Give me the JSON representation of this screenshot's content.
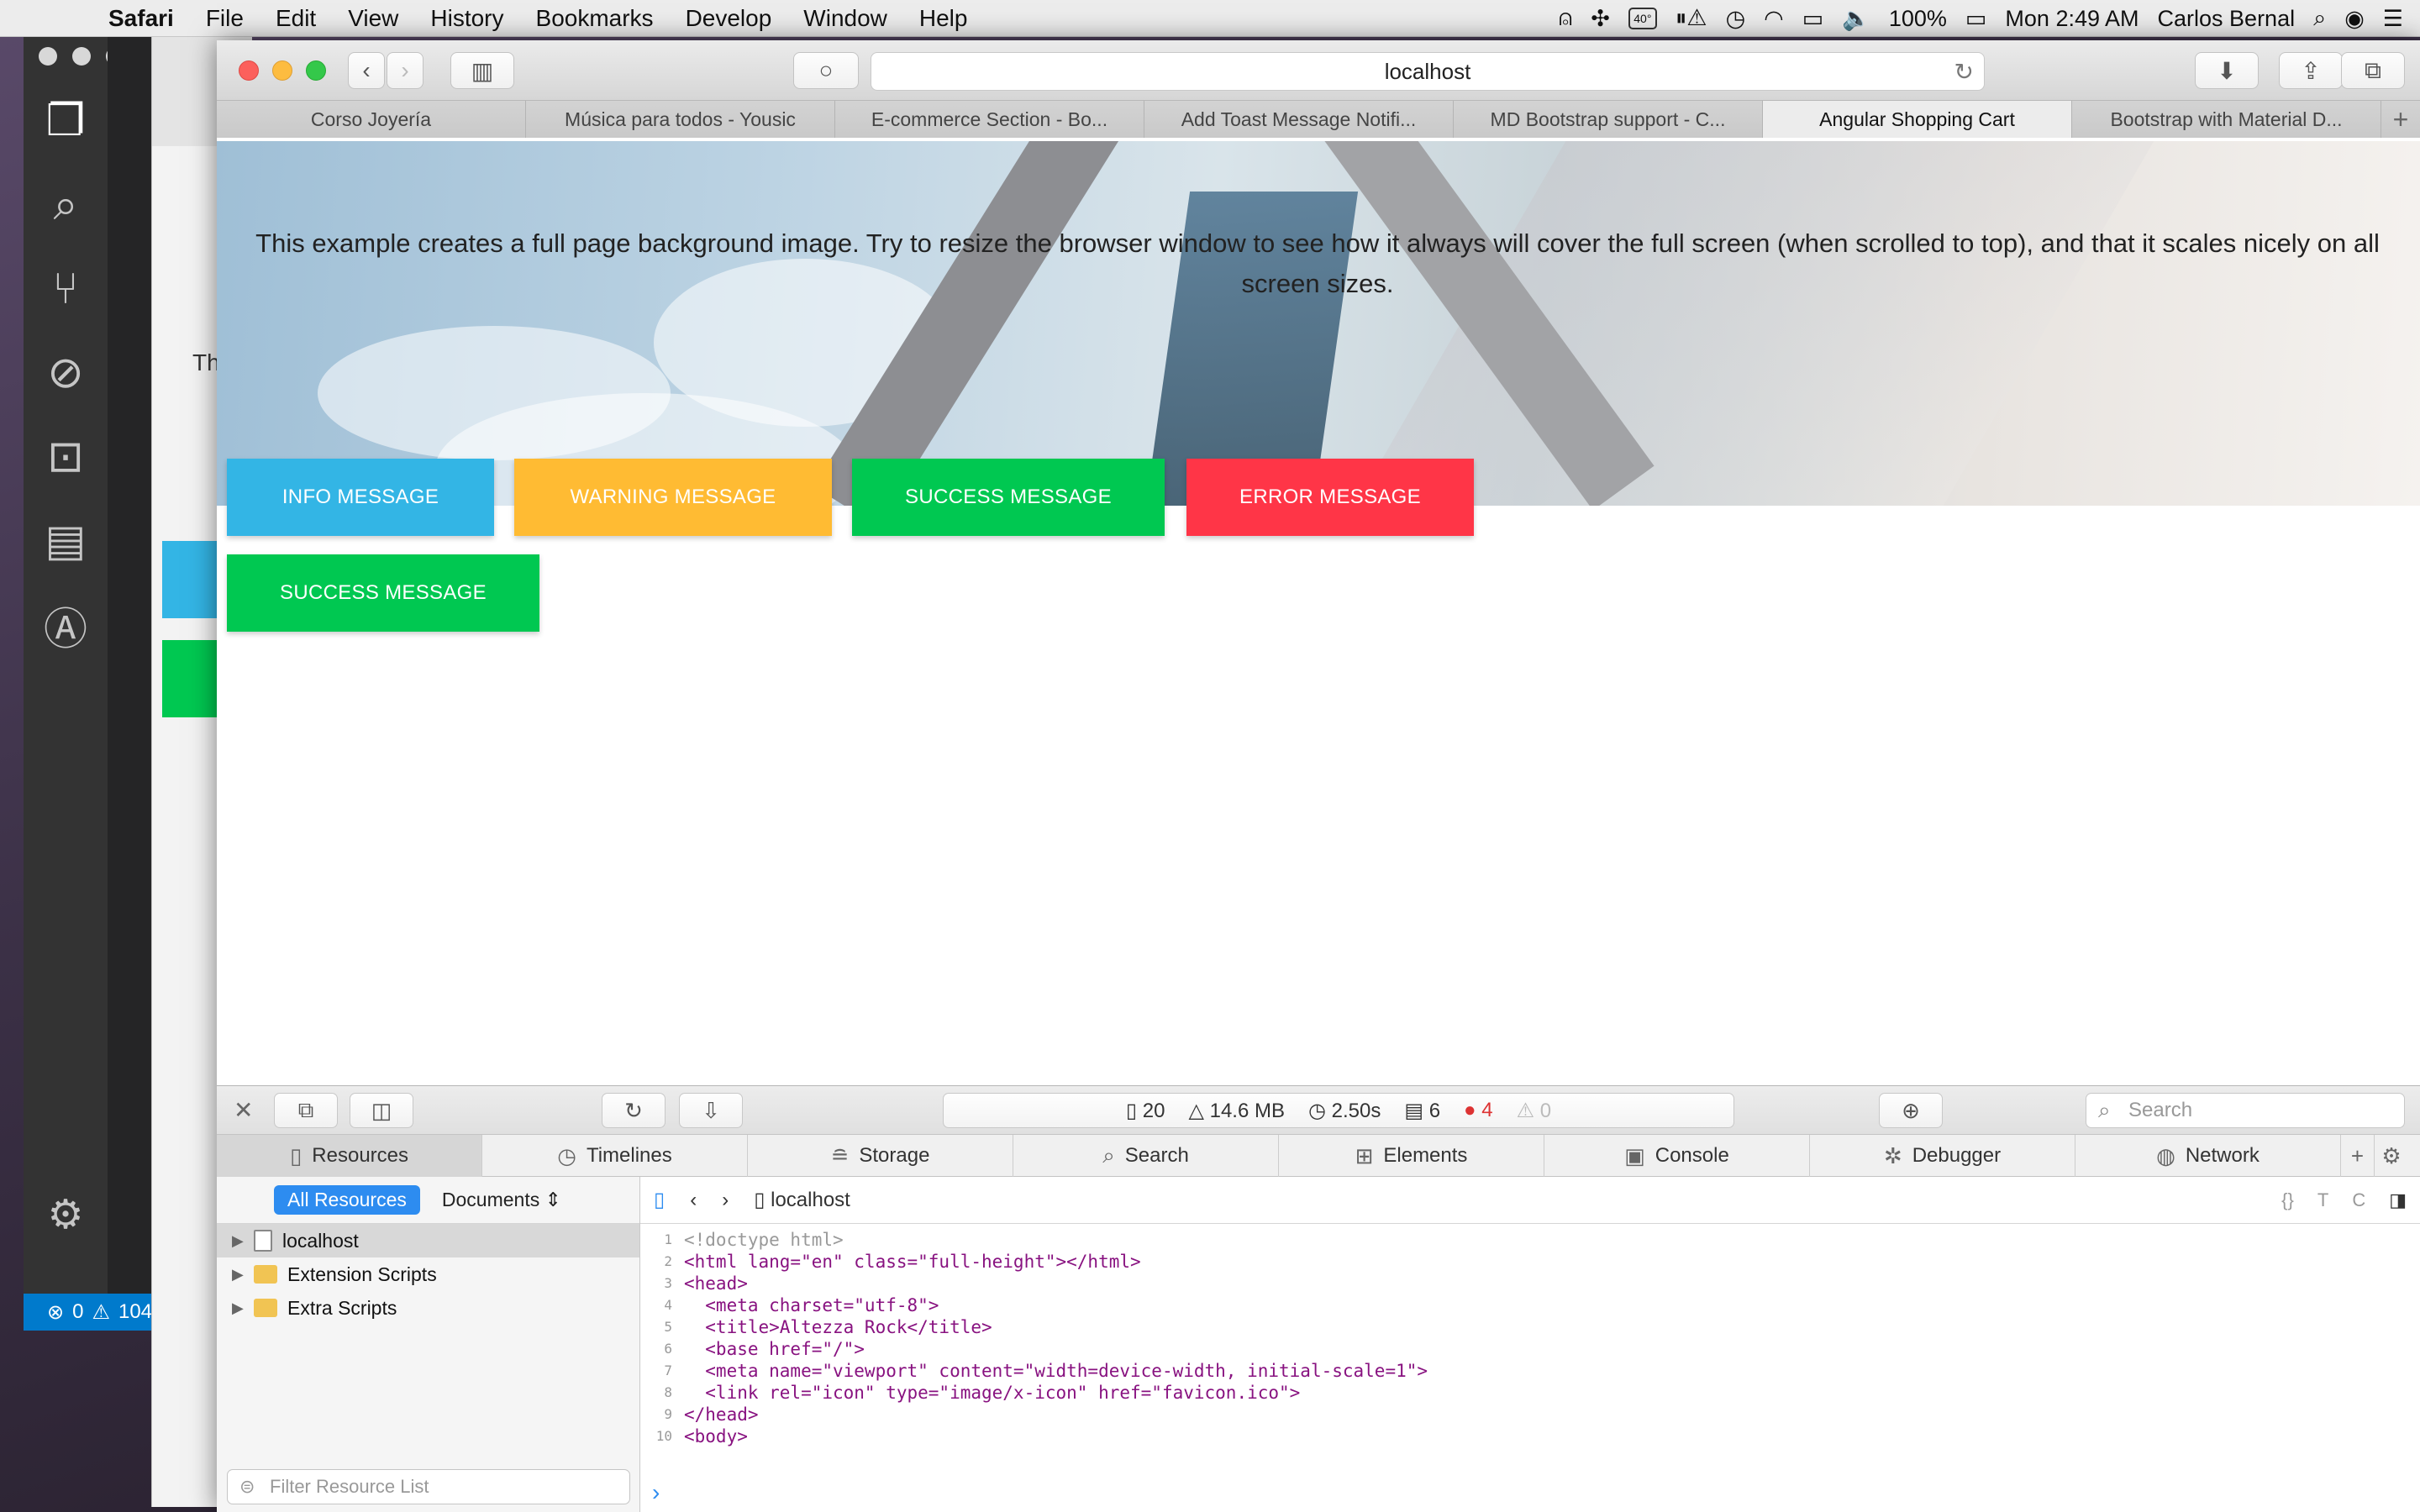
{
  "menubar": {
    "apple": "",
    "items": [
      "Safari",
      "File",
      "Edit",
      "View",
      "History",
      "Bookmarks",
      "Develop",
      "Window",
      "Help"
    ],
    "right": {
      "temp": "40°",
      "battery": "100%",
      "clock": "Mon 2:49 AM",
      "user": "Carlos Bernal"
    }
  },
  "vscode": {
    "errors": "0",
    "warnings": "104"
  },
  "bgwin": {
    "text": "Th"
  },
  "safari": {
    "url": "localhost",
    "tabs": [
      {
        "label": "Corso Joyería",
        "active": false
      },
      {
        "label": "Música para todos - Yousic",
        "active": false
      },
      {
        "label": "E-commerce Section - Bo...",
        "active": false
      },
      {
        "label": "Add Toast Message Notifi...",
        "active": false
      },
      {
        "label": "MD Bootstrap support - C...",
        "active": false
      },
      {
        "label": "Angular Shopping Cart",
        "active": true
      },
      {
        "label": "Bootstrap with Material D...",
        "active": false
      }
    ],
    "new_tab": "+"
  },
  "page": {
    "hero_text": "This example creates a full page background image. Try to resize the browser window to see how it always will cover the full screen (when scrolled to top), and that it scales nicely on all screen sizes.",
    "buttons": {
      "info": "INFO MESSAGE",
      "warning": "WARNING MESSAGE",
      "success": "SUCCESS MESSAGE",
      "error": "ERROR MESSAGE",
      "success2": "SUCCESS MESSAGE"
    }
  },
  "inspector": {
    "stats": {
      "resources": "20",
      "size": "14.6 MB",
      "time": "2.50s",
      "logs": "6",
      "errors": "4",
      "warnings": "0"
    },
    "search_placeholder": "Search",
    "tabs": [
      "Resources",
      "Timelines",
      "Storage",
      "Search",
      "Elements",
      "Console",
      "Debugger",
      "Network"
    ],
    "active_tab": "Resources",
    "scope": {
      "all": "All Resources",
      "documents": "Documents"
    },
    "tree": [
      {
        "label": "localhost",
        "type": "doc",
        "selected": true
      },
      {
        "label": "Extension Scripts",
        "type": "folder",
        "selected": false
      },
      {
        "label": "Extra Scripts",
        "type": "folder",
        "selected": false
      }
    ],
    "filter_placeholder": "Filter Resource List",
    "nav_file": "localhost"
  },
  "code": [
    "<!doctype html>",
    "<html lang=\"en\" class=\"full-height\"></html>",
    "<head>",
    "  <meta charset=\"utf-8\">",
    "  <title>Altezza Rock</title>",
    "  <base href=\"/\">",
    "  <meta name=\"viewport\" content=\"width=device-width, initial-scale=1\">",
    "  <link rel=\"icon\" type=\"image/x-icon\" href=\"favicon.ico\">",
    "</head>",
    "<body>"
  ]
}
